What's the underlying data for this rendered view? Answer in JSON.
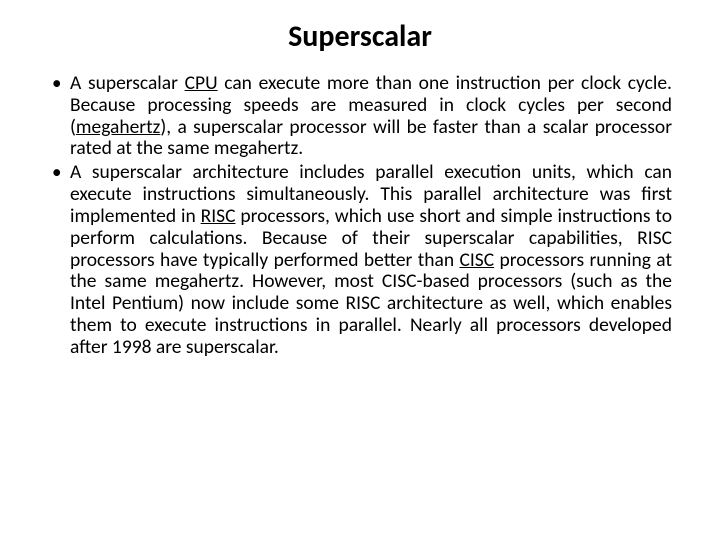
{
  "title": "Superscalar",
  "bullets": [
    {
      "pre1": "A superscalar ",
      "link1": "CPU",
      "mid1": " can execute more than one instruction per clock cycle. Because processing speeds are measured in clock cycles per second (",
      "link2": "megahertz",
      "post1": "), a superscalar processor will be faster than a scalar processor rated at the same megahertz."
    },
    {
      "pre1": "A superscalar architecture includes parallel execution units, which can execute instructions simultaneously. This parallel architecture was first implemented in ",
      "link1": "RISC",
      "mid1": " processors, which use short and simple instructions to perform calculations. Because of their superscalar capabilities, RISC processors have typically performed better than ",
      "link2": "CISC",
      "post1": " processors running at the same megahertz. However, most CISC-based processors (such as the Intel Pentium) now include some RISC architecture as well, which enables them to execute instructions in parallel. Nearly all processors developed after 1998 are superscalar."
    }
  ]
}
